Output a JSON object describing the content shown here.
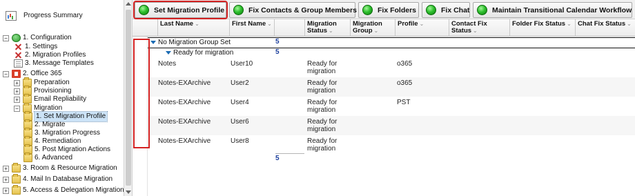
{
  "tree": {
    "items": [
      {
        "label": "Progress Summary",
        "icon": "chart-icon",
        "expander": ""
      },
      {
        "label": "1. Configuration",
        "icon": "globe-icon",
        "expander": "−"
      },
      {
        "label": "1. Settings",
        "icon": "tools-icon",
        "expander": ""
      },
      {
        "label": "2. Migration Profiles",
        "icon": "tools-icon",
        "expander": ""
      },
      {
        "label": "3. Message Templates",
        "icon": "document-icon",
        "expander": ""
      },
      {
        "label": "2. Office 365",
        "icon": "office-icon",
        "expander": "−"
      },
      {
        "label": "Preparation",
        "icon": "folder-icon",
        "expander": "+"
      },
      {
        "label": "Provisioning",
        "icon": "folder-icon",
        "expander": "+"
      },
      {
        "label": "Email Repliability",
        "icon": "folder-icon",
        "expander": "+"
      },
      {
        "label": "Migration",
        "icon": "folder-icon",
        "expander": "−"
      },
      {
        "label": "1. Set Migration Profile",
        "icon": "folder-icon",
        "expander": ""
      },
      {
        "label": "2. Migrate",
        "icon": "folder-icon",
        "expander": ""
      },
      {
        "label": "3. Migration Progress",
        "icon": "folder-icon",
        "expander": ""
      },
      {
        "label": "4. Remediation",
        "icon": "folder-icon",
        "expander": ""
      },
      {
        "label": "5. Post Migration Actions",
        "icon": "folder-icon",
        "expander": ""
      },
      {
        "label": "6. Advanced",
        "icon": "folder-icon",
        "expander": ""
      },
      {
        "label": "3. Room & Resource Migration",
        "icon": "folder-icon",
        "expander": "+"
      },
      {
        "label": "4. Mail In Database Migration",
        "icon": "folder-icon",
        "expander": "+"
      },
      {
        "label": "5. Access & Delegation Migration",
        "icon": "folder-icon",
        "expander": "+"
      }
    ],
    "selected_index": 10
  },
  "toolbar": {
    "buttons": [
      {
        "label": "Set Migration Profile",
        "active": true
      },
      {
        "label": "Fix Contacts & Group Members",
        "active": false
      },
      {
        "label": "Fix Folders",
        "active": false
      },
      {
        "label": "Fix Chat",
        "active": false
      },
      {
        "label": "Maintain Transitional Calendar Workflow",
        "active": false
      }
    ]
  },
  "grid": {
    "columns": [
      {
        "label": "Last Name",
        "sort": "⌄"
      },
      {
        "label": "First Name",
        "sort": "⌄"
      },
      {
        "label": "Migration Status",
        "sort": "⌄"
      },
      {
        "label": "Migration Group",
        "sort": "⌄"
      },
      {
        "label": "Profile",
        "sort": "⌄"
      },
      {
        "label": "Contact Fix Status",
        "sort": "⌄"
      },
      {
        "label": "Folder Fix Status",
        "sort": "⌄"
      },
      {
        "label": "Chat Fix Status",
        "sort": "⌄"
      }
    ],
    "group_1": {
      "label": "No Migration Group Set",
      "count": "5"
    },
    "group_2": {
      "label": "Ready for migration",
      "count": "5"
    },
    "rows": [
      {
        "last": "Notes",
        "first": "User10",
        "status": "Ready for migration",
        "group": "",
        "profile": "o365"
      },
      {
        "last": "Notes-EXArchive",
        "first": "User2",
        "status": "Ready for migration",
        "group": "",
        "profile": "o365"
      },
      {
        "last": "Notes-EXArchive",
        "first": "User4",
        "status": "Ready for migration",
        "group": "",
        "profile": "PST"
      },
      {
        "last": "Notes-EXArchive",
        "first": "User6",
        "status": "Ready for migration",
        "group": "",
        "profile": ""
      },
      {
        "last": "Notes-EXArchive",
        "first": "User8",
        "status": "Ready for migration",
        "group": "",
        "profile": ""
      }
    ],
    "total": "5"
  },
  "colors": {
    "highlight": "#d42222",
    "button_green": "#2fc12f",
    "count_blue": "#1a3d9c"
  }
}
